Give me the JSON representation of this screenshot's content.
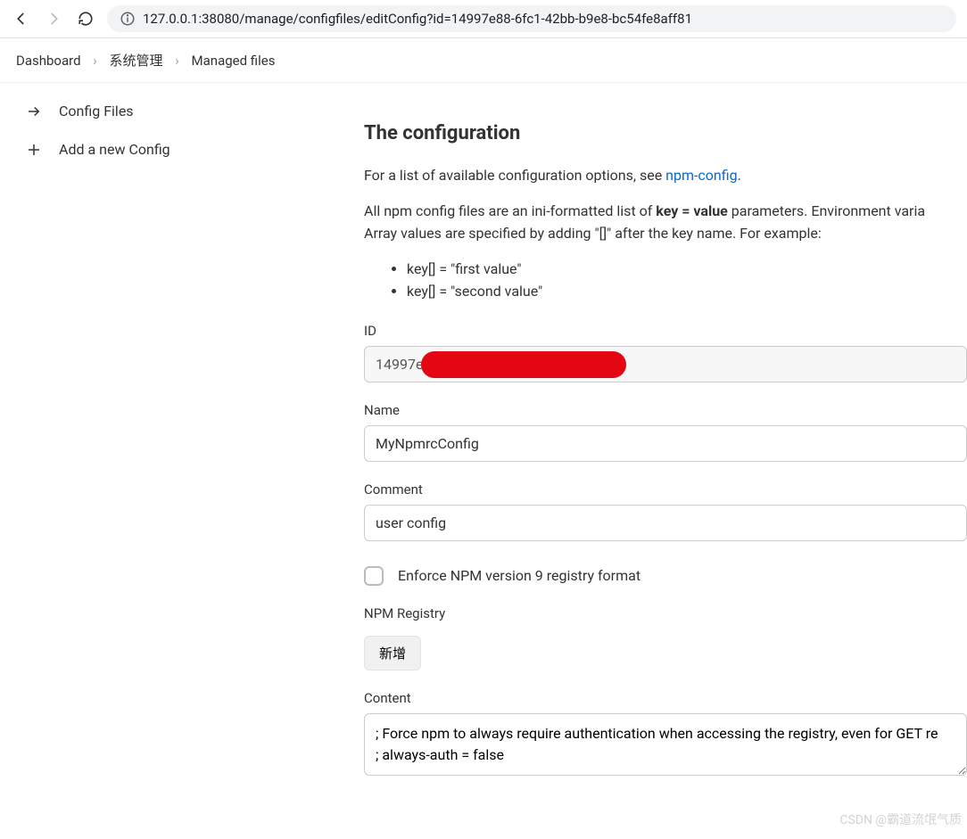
{
  "browser": {
    "url": "127.0.0.1:38080/manage/configfiles/editConfig?id=14997e88-6fc1-42bb-b9e8-bc54fe8aff81"
  },
  "breadcrumb": {
    "items": [
      "Dashboard",
      "系统管理",
      "Managed files"
    ]
  },
  "sidebar": {
    "items": [
      {
        "icon": "arrow-right",
        "label": "Config Files"
      },
      {
        "icon": "plus",
        "label": "Add a new Config"
      }
    ]
  },
  "page": {
    "heading": "The configuration",
    "intro": "For a list of available configuration options, see ",
    "intro_link": "npm-config",
    "intro_end": ".",
    "paragraph2_a": "All npm config files are an ini-formatted list of ",
    "paragraph2_b": "key = value",
    "paragraph2_c": " parameters. Environment varia",
    "paragraph2_d": "Array values are specified by adding \"[]\" after the key name. For example:",
    "examples": [
      "key[] = \"first value\"",
      "key[] = \"second value\""
    ],
    "fields": {
      "id": {
        "label": "ID",
        "value": "14997e                                             f81"
      },
      "name": {
        "label": "Name",
        "value": "MyNpmrcConfig"
      },
      "comment": {
        "label": "Comment",
        "value": "user config"
      },
      "enforce": {
        "label": "Enforce NPM version 9 registry format",
        "checked": false
      },
      "registry": {
        "label": "NPM Registry",
        "add_button": "新增"
      },
      "content": {
        "label": "Content",
        "value": "; Force npm to always require authentication when accessing the registry, even for GET re\n; always-auth = false"
      }
    }
  },
  "watermark": "CSDN @霸道流氓气质"
}
